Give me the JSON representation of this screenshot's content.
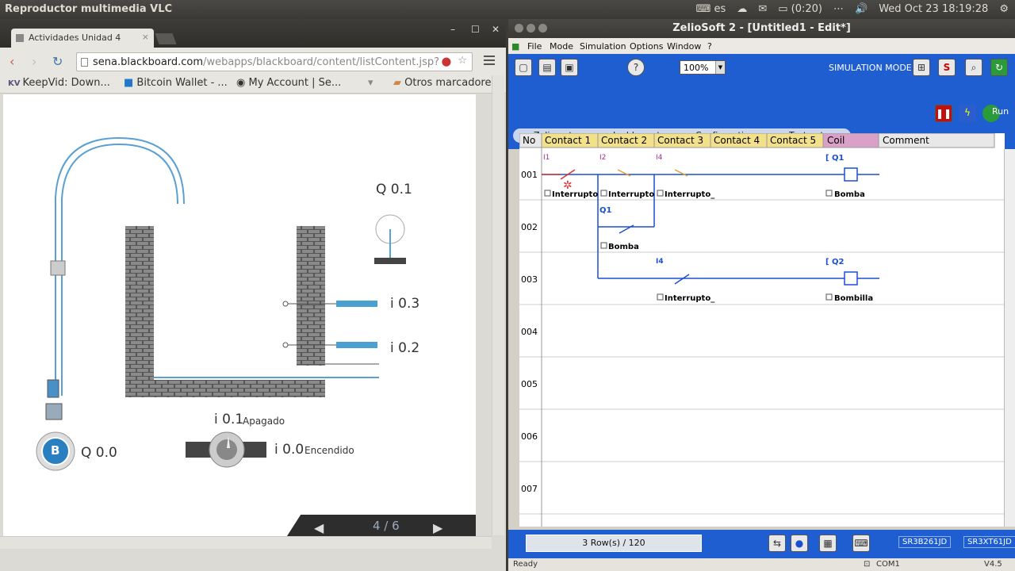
{
  "system": {
    "app_title": "Reproductor multimedia VLC",
    "keyboard": "es",
    "battery": "(0:20)",
    "clock": "Wed Oct 23  18:19:28"
  },
  "browser": {
    "tab_title": "Actividades Unidad 4",
    "url_host": "sena.blackboard.com",
    "url_path": "/webapps/blackboard/content/listContent.jsp?",
    "bookmarks": [
      "KeepVid: Down...",
      "Bitcoin Wallet - ...",
      "My Account | Se...",
      "Otros marcadores"
    ],
    "bookmark_kv": "KV"
  },
  "sim": {
    "q01": "Q 0.1",
    "i03": "i 0.3",
    "i02": "i 0.2",
    "i01": "i 0.1",
    "apagado": "Apagado",
    "i00": "i 0.0",
    "encendido": "Encendido",
    "b": "B",
    "q00": "Q 0.0",
    "pager": "4 / 6"
  },
  "zelio": {
    "title": "ZelioSoft 2 - [Untitled1 - Edit*]",
    "menu": [
      "File",
      "Mode",
      "Simulation",
      "Options",
      "Window",
      "?"
    ],
    "zoom": "100%",
    "sim_mode": "SIMULATION MODE",
    "run": "Run",
    "mode_tabs": [
      "Zelio entry",
      "Ladder entry",
      "Configuration",
      "Text entry"
    ],
    "columns": [
      "No",
      "Contact 1",
      "Contact 2",
      "Contact 3",
      "Contact 4",
      "Contact 5",
      "Coil",
      "Comment"
    ],
    "row_numbers": [
      "001",
      "002",
      "003",
      "004",
      "005",
      "006",
      "007"
    ],
    "contacts": {
      "r1c1_tag": "I1",
      "r1c1_name": "Interrupto",
      "r1c2_tag": "I2",
      "r1c2_name": "Interrupto",
      "r1c3_tag": "I4",
      "r1c3_name": "Interrupto_",
      "r1_coil_tag": "[ Q1",
      "r1_coil_name": "Bomba",
      "r2c2_tag": "Q1",
      "r2c2_name": "Bomba",
      "r3c3_tag": "I4",
      "r3c3_name": "Interrupto_",
      "r3_coil_tag": "[ Q2",
      "r3_coil_name": "Bombilla"
    },
    "rows_count": "3 Row(s) / 120",
    "refs": [
      "SR3B261JD",
      "SR3XT61JD"
    ],
    "status": "Ready",
    "com": "COM1",
    "version": "V4.5"
  }
}
